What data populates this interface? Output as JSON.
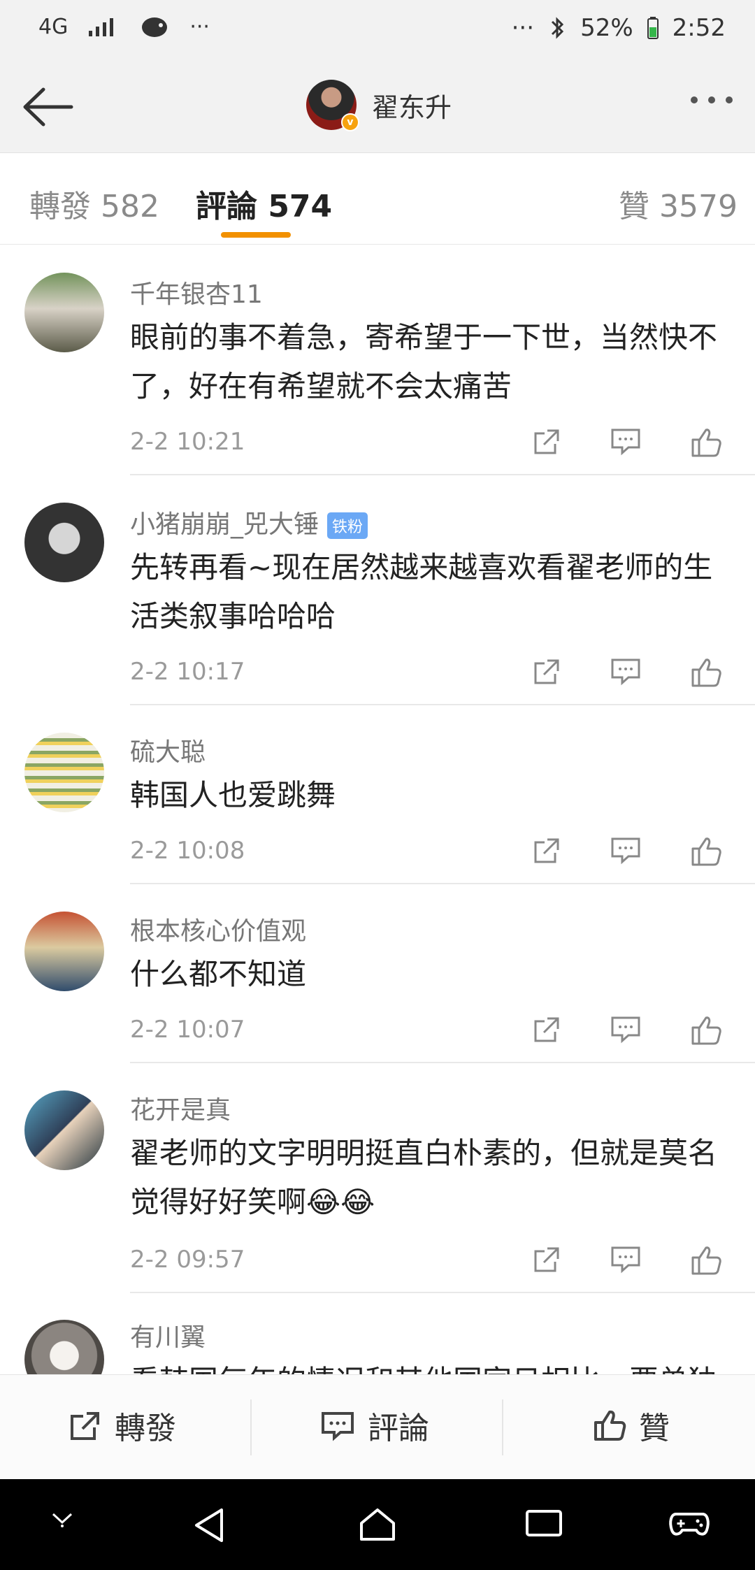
{
  "status_bar": {
    "network": "4G",
    "signal": "signal-icon",
    "icon_bird": "bird-icon",
    "dots_left": "···",
    "dots_right": "···",
    "bluetooth": "bluetooth-icon",
    "battery": "52%",
    "time": "2:52"
  },
  "header": {
    "username": "翟东升"
  },
  "tabs": {
    "repost": "轉發 582",
    "comment": "評論 574",
    "like": "贊 3579"
  },
  "comments": [
    {
      "name": "千年银杏11",
      "text": "眼前的事不着急，寄希望于一下世，当然快不了，好在有希望就不会太痛苦",
      "time": "2-2 10:21"
    },
    {
      "name": "小猪崩崩_兕大锤",
      "badge": "铁粉",
      "text": "先转再看~现在居然越来越喜欢看翟老师的生活类叙事哈哈哈",
      "time": "2-2 10:17"
    },
    {
      "name": "硫大聪",
      "text": "韩国人也爱跳舞",
      "time": "2-2 10:08"
    },
    {
      "name": "根本核心价值观",
      "text": "什么都不知道",
      "time": "2-2 10:07"
    },
    {
      "name": "花开是真",
      "text": "翟老师的文字明明挺直白朴素的，但就是莫名觉得好好笑啊😂😂",
      "time": "2-2 09:57"
    },
    {
      "name": "有川翼",
      "text": "看韩国每年的情况和其他国家日相比，要单独",
      "time": ""
    }
  ],
  "bottom": {
    "repost": "轉發",
    "comment": "評論",
    "like": "贊"
  },
  "colors": {
    "accent": "#f29100",
    "text": "#222222",
    "muted": "#9a9a9a",
    "background": "#f2f2f2"
  }
}
